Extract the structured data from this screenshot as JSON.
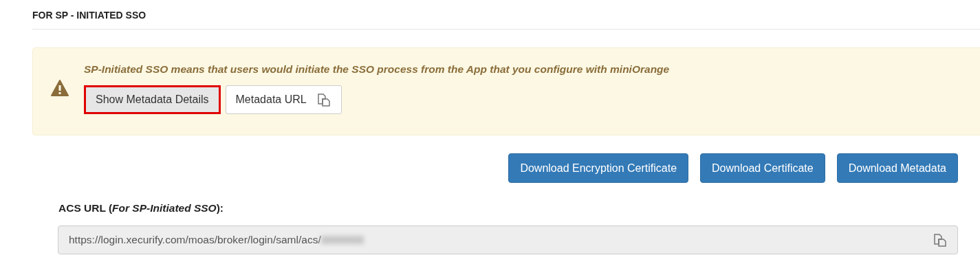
{
  "section_title": "FOR SP - INITIATED SSO",
  "alert": {
    "message": "SP-Initiated SSO means that users would initiate the SSO process from the App that you configure with miniOrange",
    "buttons": [
      {
        "label": "Show Metadata Details",
        "highlighted": true,
        "kind": "plain"
      },
      {
        "label": "Metadata URL",
        "highlighted": false,
        "kind": "copy"
      }
    ]
  },
  "downloads": [
    "Download Encryption Certificate",
    "Download Certificate",
    "Download Metadata"
  ],
  "acs_field": {
    "label": "ACS URL **(*For SP-Initiated SSO*)**:",
    "value": "https://login.xecurify.com/moas/broker/login/saml/acs/",
    "redacted": true
  }
}
